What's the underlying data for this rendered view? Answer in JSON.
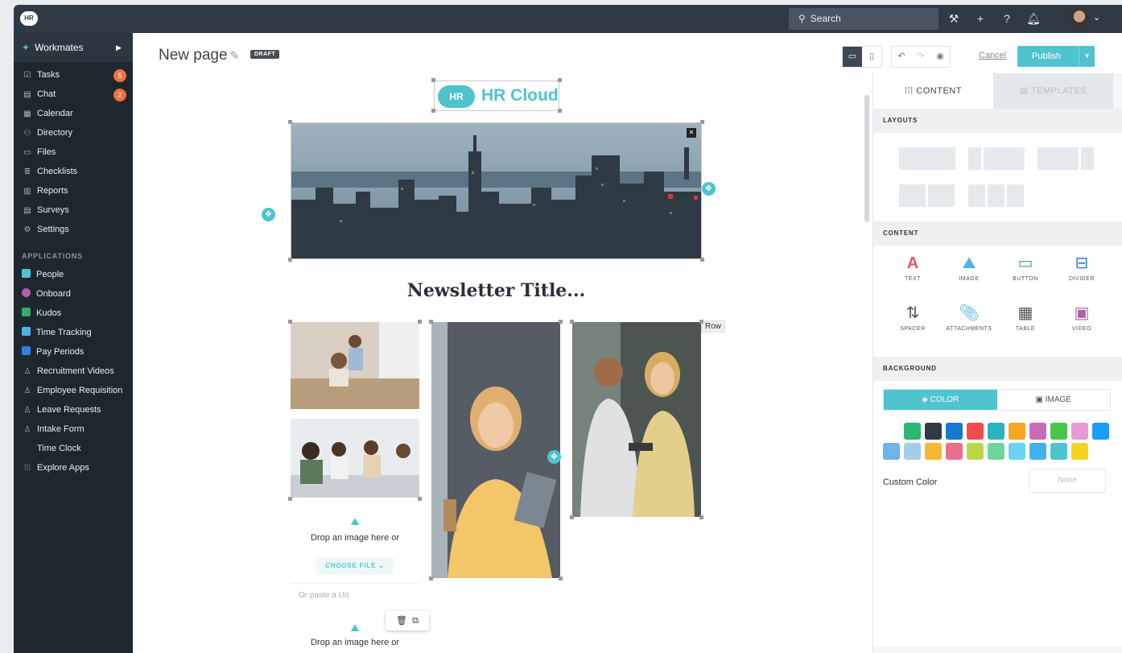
{
  "topbar": {
    "logo": "HR",
    "search_placeholder": "Search",
    "icons": [
      "wrench-icon",
      "plus-icon",
      "help-icon",
      "bell-icon"
    ]
  },
  "sidebar": {
    "workspace": "Workmates",
    "items": [
      {
        "label": "Tasks",
        "icon": "checkbox-icon",
        "badge": "5"
      },
      {
        "label": "Chat",
        "icon": "chat-icon",
        "badge": "2"
      },
      {
        "label": "Calendar",
        "icon": "calendar-icon"
      },
      {
        "label": "Directory",
        "icon": "people-icon"
      },
      {
        "label": "Files",
        "icon": "folder-icon"
      },
      {
        "label": "Checklists",
        "icon": "checklist-icon"
      },
      {
        "label": "Reports",
        "icon": "report-icon"
      },
      {
        "label": "Surveys",
        "icon": "survey-icon"
      },
      {
        "label": "Settings",
        "icon": "gear-icon"
      }
    ],
    "applications_label": "APPLICATIONS",
    "apps": [
      {
        "label": "People",
        "color": "#4fc3ce"
      },
      {
        "label": "Onboard",
        "color": "#b05fa8"
      },
      {
        "label": "Kudos",
        "color": "#3aa96b"
      },
      {
        "label": "Time Tracking",
        "color": "#4fb3e8"
      },
      {
        "label": "Pay Periods",
        "color": "#2f7ee0"
      },
      {
        "label": "Recruitment Videos",
        "color": "#8a949d"
      },
      {
        "label": "Employee Requisition",
        "color": "#8a949d"
      },
      {
        "label": "Leave Requests",
        "color": "#8a949d"
      },
      {
        "label": "Intake Form",
        "color": "#8a949d"
      },
      {
        "label": "Time Clock",
        "color": "#1f272e"
      },
      {
        "label": "Explore Apps",
        "color": "#4fc3ce"
      }
    ]
  },
  "editor": {
    "page_title": "New page",
    "status": "DRAFT",
    "cancel": "Cancel",
    "publish": "Publish"
  },
  "canvas": {
    "logo_badge": "HR",
    "logo_text": "HR Cloud",
    "newsletter_title": "Newsletter Title...",
    "row_tag": "Row",
    "drop_text": "Drop an image here or",
    "choose_file": "CHOOSE FILE ⌄",
    "paste_placeholder": "Or paste a Url",
    "drop_text_2": "Drop an image here or"
  },
  "panel": {
    "tab_content": "CONTENT",
    "tab_templates": "TEMPLATES",
    "layouts_label": "LAYOUTS",
    "content_label": "CONTENT",
    "blocks": [
      {
        "label": "TEXT",
        "icon": "text-icon",
        "color": "#f05060"
      },
      {
        "label": "IMAGE",
        "icon": "image-icon",
        "color": "#4fb3e8"
      },
      {
        "label": "BUTTON",
        "icon": "button-icon",
        "color": "#3aa96b"
      },
      {
        "label": "DIVIDER",
        "icon": "divider-icon",
        "color": "#2f7ee0"
      },
      {
        "label": "SPACER",
        "icon": "spacer-icon",
        "color": "#555"
      },
      {
        "label": "ATTACHMENTS",
        "icon": "paperclip-icon",
        "color": "#4fb3e8"
      },
      {
        "label": "TABLE",
        "icon": "table-icon",
        "color": "#555"
      },
      {
        "label": "VIDEO",
        "icon": "video-icon",
        "color": "#b05fa8"
      }
    ],
    "background_label": "BACKGROUND",
    "bg_color_tab": "COLOR",
    "bg_image_tab": "IMAGE",
    "swatches": [
      "#ffffff",
      "#2bb673",
      "#2f3a45",
      "#1877cf",
      "#f04c4c",
      "#2ab3c1",
      "#f5a623",
      "#c56db7",
      "#4cc44c",
      "#e89bd6",
      "#1a9ef5",
      "#6fb3e8",
      "#a3cde9",
      "#f7b731",
      "#ec6f8e",
      "#b8d943",
      "#6ed69a",
      "#69d3f0",
      "#40b3ef",
      "#4fc3ce",
      "#f7d21c"
    ],
    "custom_color_label": "Custom Color",
    "custom_color_value": "None"
  }
}
